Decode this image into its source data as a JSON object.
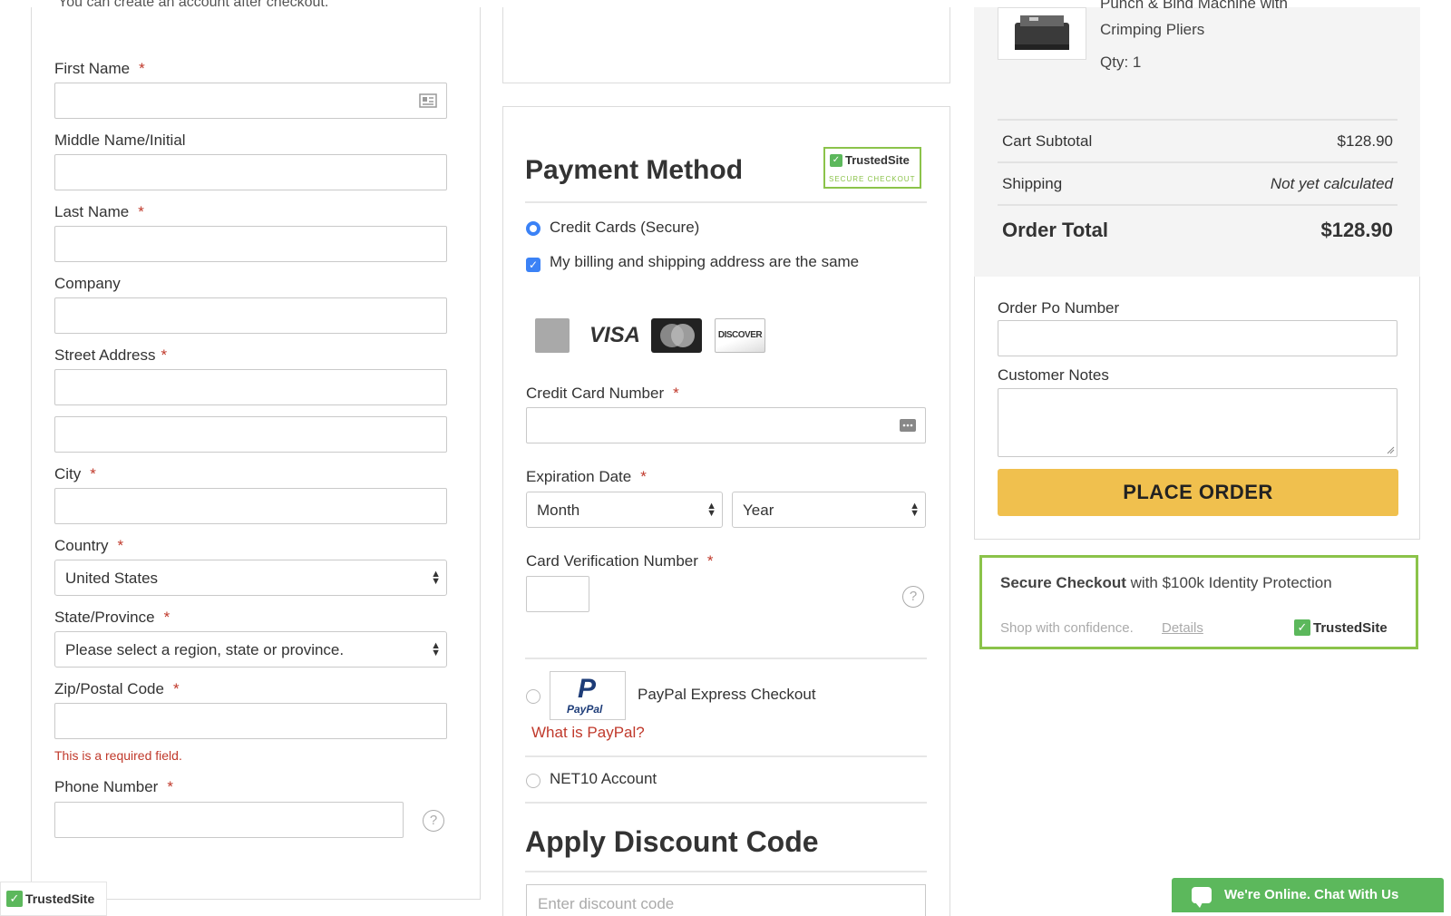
{
  "left_form": {
    "cut_text": "You can create an account after checkout.",
    "first_name_label": "First Name",
    "middle_name_label": "Middle Name/Initial",
    "last_name_label": "Last Name",
    "company_label": "Company",
    "street_label": "Street Address",
    "city_label": "City",
    "country_label": "Country",
    "country_value": "United States",
    "state_label": "State/Province",
    "state_value": "Please select a region, state or province.",
    "zip_label": "Zip/Postal Code",
    "zip_error": "This is a required field.",
    "phone_label": "Phone Number",
    "required_mark": "*",
    "help_glyph": "?"
  },
  "payment": {
    "title": "Payment Method",
    "trusted_badge": "TrustedSite",
    "trusted_sub": "SECURE CHECKOUT",
    "credit_cards_label": "Credit Cards (Secure)",
    "same_address_label": "My billing and shipping address are the same",
    "visa_text": "VISA",
    "discover_text": "DISCOVER",
    "cc_number_label": "Credit Card Number",
    "exp_label": "Expiration Date",
    "month_value": "Month",
    "year_value": "Year",
    "cvv_label": "Card Verification Number",
    "paypal_label": "PayPal Express Checkout",
    "paypal_logo_text": "PayPal",
    "paypal_logo_p": "P",
    "what_is_paypal": "What is PayPal?",
    "net10_label": "NET10 Account",
    "credit_cards_selected": true,
    "same_address_checked": true,
    "icons": [
      "amex-card-icon",
      "visa-card-icon",
      "mastercard-icon",
      "discover-card-icon",
      "card-icon",
      "contact-card-icon"
    ]
  },
  "discount": {
    "title": "Apply Discount Code",
    "placeholder": "Enter discount code"
  },
  "summary": {
    "product_name_line1": "Punch & Bind Machine with",
    "product_name_line2": "Crimping Pliers",
    "qty": "Qty: 1",
    "subtotal_label": "Cart Subtotal",
    "subtotal_value": "$128.90",
    "shipping_label": "Shipping",
    "shipping_value": "Not yet calculated",
    "total_label": "Order Total",
    "total_value": "$128.90",
    "po_label": "Order Po Number",
    "notes_label": "Customer Notes",
    "place_order": "PLACE ORDER",
    "accent_color": "#f0c04e"
  },
  "secure": {
    "title_bold": "Secure Checkout",
    "title_rest": "with $100k Identity Protection",
    "sub": "Shop with confidence.",
    "details": "Details",
    "badge": "TrustedSite",
    "border_color": "#8bc34a"
  },
  "chat": {
    "label": "We're Online. Chat With Us",
    "color": "#5cb85c"
  },
  "corner_badge": {
    "label": "TrustedSite"
  }
}
